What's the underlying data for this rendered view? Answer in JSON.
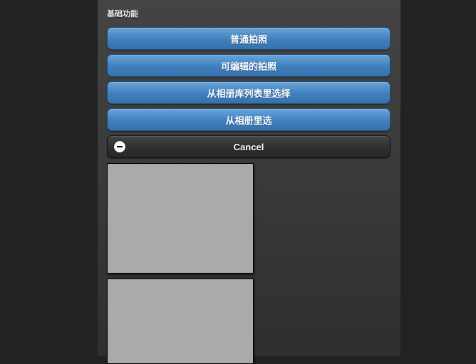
{
  "section": {
    "title": "基础功能"
  },
  "buttons": {
    "take_photo": "普通拍照",
    "editable_photo": "可编辑的拍照",
    "pick_from_library_list": "从相册库列表里选择",
    "pick_from_album": "从相册里选",
    "cancel": "Cancel"
  },
  "icons": {
    "cancel_icon": "minus-circle-icon"
  },
  "colors": {
    "background": "#222222",
    "panel": "#3b3b3b",
    "button_blue": "#4682c0",
    "button_dark": "#333333",
    "photo_placeholder": "#aaaaaa"
  }
}
